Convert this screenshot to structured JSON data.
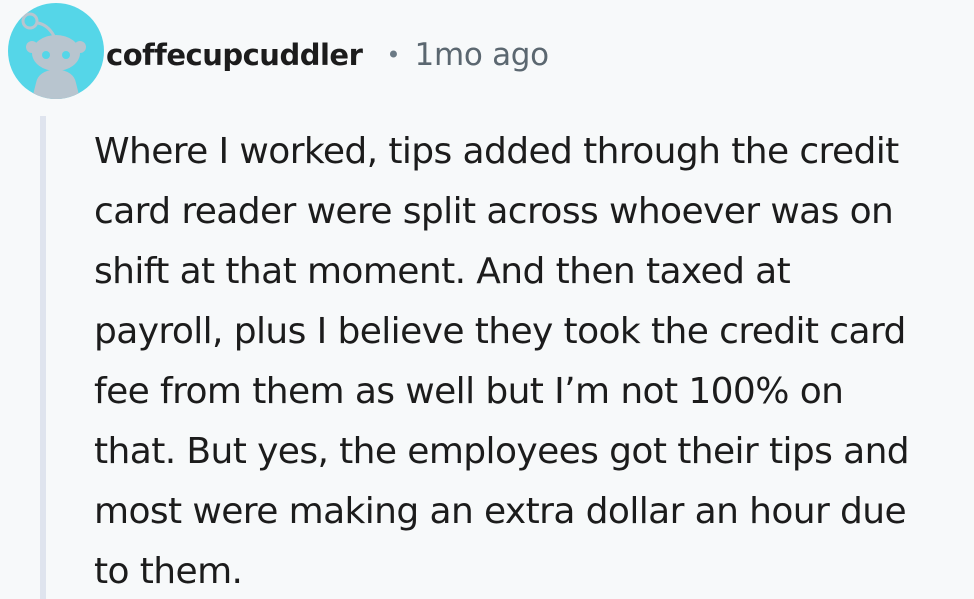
{
  "comment": {
    "username": "coffecupcuddler",
    "separator": "•",
    "timestamp": "1mo ago",
    "avatar_icon": "snoo-avatar-icon",
    "avatar_color": "#55d6e8",
    "body_lines": [
      "Where I worked, tips added through the credit",
      "card reader were split across whoever was on",
      "shift at that moment. And then taxed at",
      "payroll, plus I believe they took the credit card",
      "fee from them as well but I’m not 100% on",
      "that. But yes, the employees got their tips and",
      "most were making an extra dollar an hour due",
      "to them."
    ]
  }
}
